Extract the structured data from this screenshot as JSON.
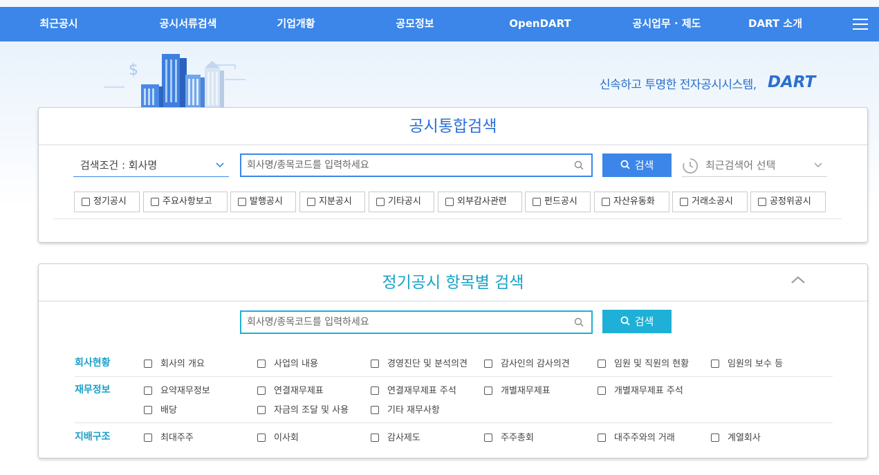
{
  "nav": {
    "items": [
      "최근공시",
      "공시서류검색",
      "기업개황",
      "공모정보",
      "OpenDART",
      "공시업무 · 제도",
      "DART 소개"
    ]
  },
  "hero": {
    "tagline": "신속하고 투명한 전자공시시스템,",
    "logo": "DART"
  },
  "integrated_search": {
    "title": "공시통합검색",
    "condition_select": "검색조건 : 회사명",
    "input_placeholder": "회사명/종목코드를 입력하세요",
    "search_button": "검색",
    "recent_select": "최근검색어 선택",
    "filters": [
      "정기공시",
      "주요사항보고",
      "발행공시",
      "지분공시",
      "기타공시",
      "외부감사관련",
      "펀드공시",
      "자산유동화",
      "거래소공시",
      "공정위공시"
    ]
  },
  "item_search": {
    "title": "정기공시 항목별 검색",
    "input_placeholder": "회사명/종목코드를 입력하세요",
    "search_button": "검색",
    "groups": [
      {
        "label": "회사현황",
        "items": [
          "회사의 개요",
          "사업의 내용",
          "경영진단 및 분석의견",
          "감사인의 감사의견",
          "임원 및 직원의 현황",
          "임원의 보수 등"
        ]
      },
      {
        "label": "재무정보",
        "items": [
          "요약재무정보",
          "연결재무제표",
          "연결재무제표 주석",
          "개별재무제표",
          "개별재무제표 주석",
          "배당",
          "자금의 조달 및 사용",
          "기타 재무사항"
        ]
      },
      {
        "label": "지배구조",
        "items": [
          "최대주주",
          "이사회",
          "감사제도",
          "주주총회",
          "대주주와의 거래",
          "계열회사"
        ]
      }
    ]
  },
  "colors": {
    "nav_bg": "#3b86e8",
    "primary_blue": "#3b86e8",
    "accent_cyan": "#1eb0d6"
  },
  "icons": [
    "menu-icon",
    "search-icon",
    "chevron-down-icon",
    "clock-icon",
    "chevron-up-icon",
    "buildings-illustration"
  ]
}
